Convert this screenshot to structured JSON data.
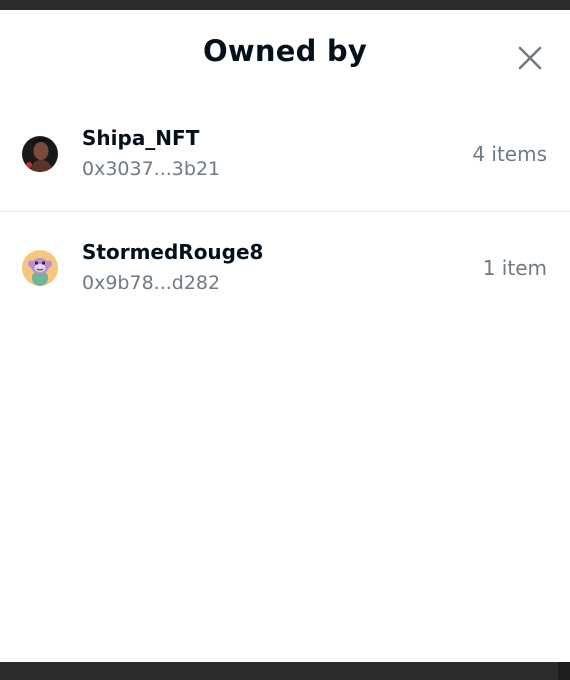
{
  "modal": {
    "title": "Owned by",
    "close_icon": "close-icon"
  },
  "owners": [
    {
      "name": "Shipa_NFT",
      "address": "0x3037...3b21",
      "count": "4 items",
      "avatar_icon": "portrait-avatar"
    },
    {
      "name": "StormedRouge8",
      "address": "0x9b78...d282",
      "count": "1 item",
      "avatar_icon": "cartoon-ape-avatar"
    }
  ],
  "colors": {
    "title": "#04111d",
    "secondary_text": "#707a83",
    "divider": "#e5e8eb",
    "close_icon": "#707a83"
  }
}
